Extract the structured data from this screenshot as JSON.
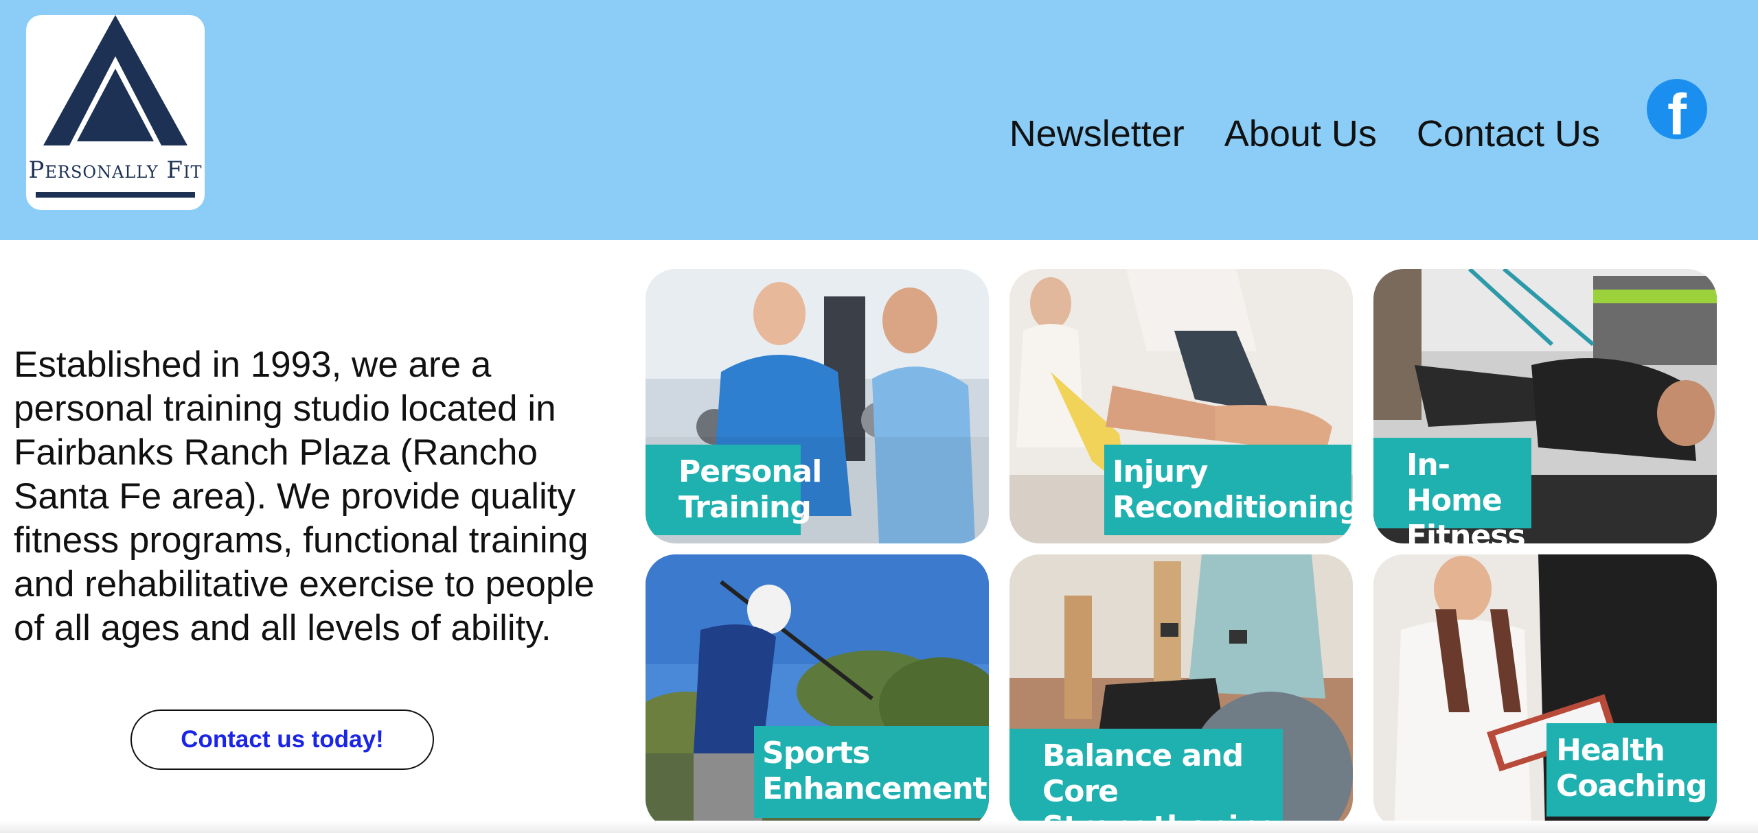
{
  "brand": {
    "name": "Personally Fit",
    "colors": {
      "header_bg": "#8bcdf6",
      "logo_navy": "#1c3154",
      "accent_teal": "#1fb0b0",
      "cta_text": "#1a25e6",
      "facebook_blue": "#1b8ff0"
    }
  },
  "nav": {
    "items": [
      {
        "label": "Newsletter"
      },
      {
        "label": "About Us"
      },
      {
        "label": "Contact Us"
      }
    ],
    "social_icon": "facebook-icon",
    "social_glyph": "f"
  },
  "intro": {
    "text": "Established in 1993, we are a personal training studio located in Fairbanks Ranch Plaza (Rancho Santa Fe area). We provide quality fitness programs, functional training and rehabilitative exercise to people of all ages and all levels of ability.",
    "cta_label": "Contact us today!"
  },
  "services": [
    {
      "line1": "Personal",
      "line2": "Training"
    },
    {
      "line1": "Injury",
      "line2": "Reconditioning"
    },
    {
      "line1": "In-Home",
      "line2": "Fitness"
    },
    {
      "line1": "Sports",
      "line2": "Enhancement"
    },
    {
      "line1": "Balance and Core",
      "line2": "Strengthening"
    },
    {
      "line1": "Health",
      "line2": "Coaching"
    }
  ]
}
